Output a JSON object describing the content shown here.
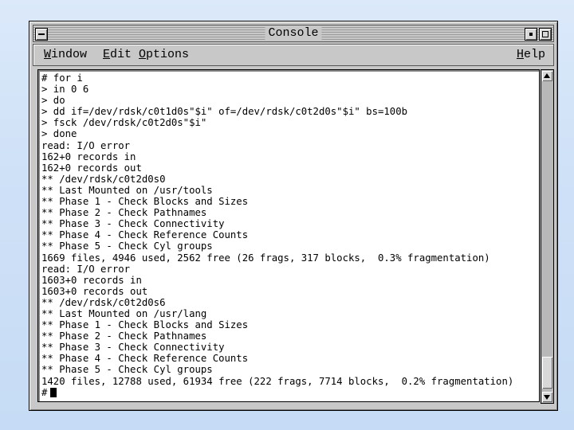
{
  "window": {
    "title": "Console",
    "menu": {
      "window": {
        "mnemonic": "W",
        "rest": "indow"
      },
      "edit": {
        "mnemonic": "E",
        "rest": "dit"
      },
      "options": {
        "mnemonic": "O",
        "rest": "ptions"
      },
      "help": {
        "mnemonic": "H",
        "rest": "elp"
      }
    }
  },
  "console": {
    "lines": [
      "# for i",
      "> in 0 6",
      "> do",
      "> dd if=/dev/rdsk/c0t1d0s\"$i\" of=/dev/rdsk/c0t2d0s\"$i\" bs=100b",
      "> fsck /dev/rdsk/c0t2d0s\"$i\"",
      "> done",
      "read: I/O error",
      "162+0 records in",
      "162+0 records out",
      "** /dev/rdsk/c0t2d0s0",
      "** Last Mounted on /usr/tools",
      "** Phase 1 - Check Blocks and Sizes",
      "** Phase 2 - Check Pathnames",
      "** Phase 3 - Check Connectivity",
      "** Phase 4 - Check Reference Counts",
      "** Phase 5 - Check Cyl groups",
      "1669 files, 4946 used, 2562 free (26 frags, 317 blocks,  0.3% fragmentation)",
      "read: I/O error",
      "1603+0 records in",
      "1603+0 records out",
      "** /dev/rdsk/c0t2d0s6",
      "** Last Mounted on /usr/lang",
      "** Phase 1 - Check Blocks and Sizes",
      "** Phase 2 - Check Pathnames",
      "** Phase 3 - Check Connectivity",
      "** Phase 4 - Check Reference Counts",
      "** Phase 5 - Check Cyl groups",
      "1420 files, 12788 used, 61934 free (222 frags, 7714 blocks,  0.2% fragmentation)"
    ],
    "prompt": "#"
  }
}
